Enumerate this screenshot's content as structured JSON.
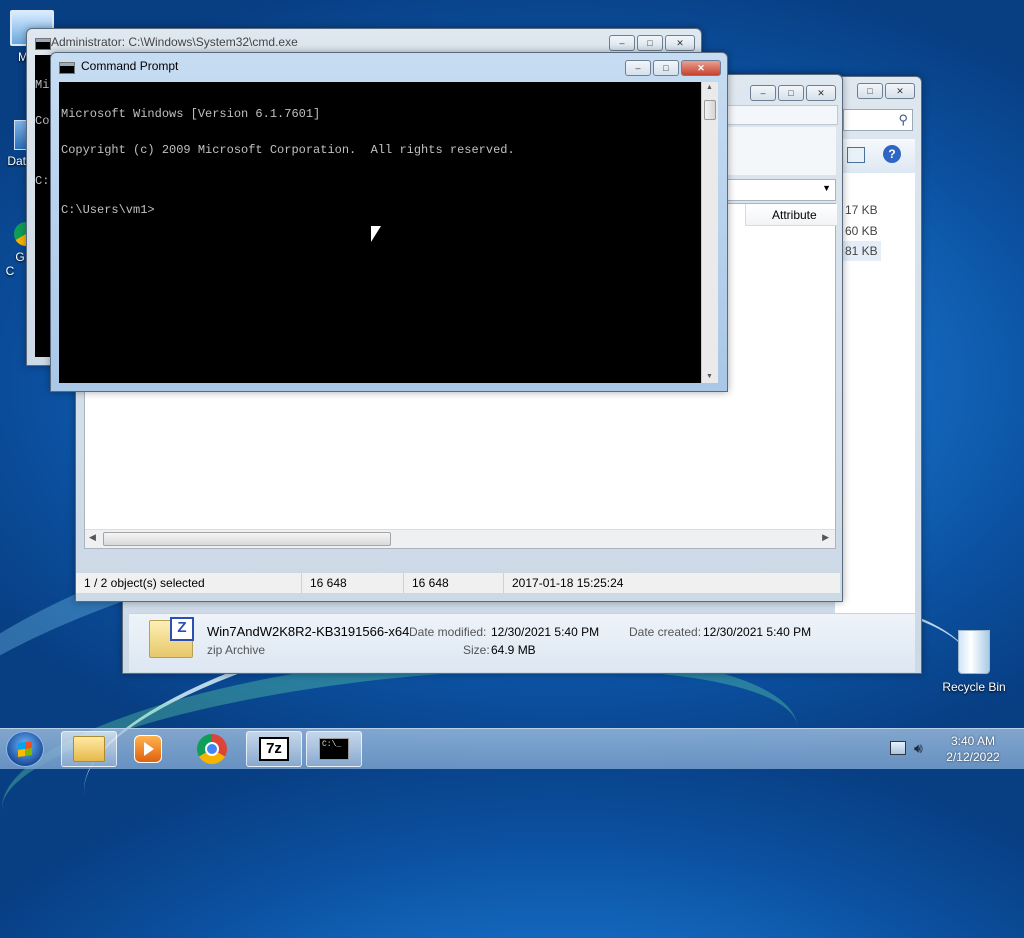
{
  "desktop": {
    "icons": [
      {
        "label": "My C"
      },
      {
        "label": "Data"
      },
      {
        "label": "G\nC"
      },
      {
        "label": "Recycle Bin"
      }
    ]
  },
  "windows": {
    "admin_cmd": {
      "title": "Administrator: C:\\Windows\\System32\\cmd.exe",
      "partial_lines": [
        "Mi",
        "Co",
        "",
        "C:"
      ]
    },
    "cmd": {
      "title": "Command Prompt",
      "lines": [
        "Microsoft Windows [Version 6.1.7601]",
        "Copyright (c) 2009 Microsoft Corporation.  All rights reserved.",
        "",
        "C:\\Users\\vm1>"
      ]
    },
    "sevenzip": {
      "column_header": "Attribute",
      "status": {
        "selected": "1 / 2 object(s) selected",
        "size": "16 648",
        "packed": "16 648",
        "modified": "2017-01-18 15:25:24"
      }
    },
    "explorer": {
      "size_column": [
        "17 KB",
        "60 KB",
        "81 KB"
      ],
      "details": {
        "filename": "Win7AndW2K8R2-KB3191566-x64",
        "type": "zip Archive",
        "date_modified_label": "Date modified:",
        "date_modified": "12/30/2021 5:40 PM",
        "date_created_label": "Date created:",
        "date_created": "12/30/2021 5:40 PM",
        "size_label": "Size:",
        "size": "64.9 MB"
      }
    }
  },
  "taskbar": {
    "buttons": [
      "start-button",
      "explorer",
      "media-player",
      "chrome",
      "7zip",
      "cmd"
    ],
    "sevenzip_label": "7z",
    "cmd_label": "C:\\_",
    "clock": {
      "time": "3:40 AM",
      "date": "2/12/2022"
    }
  }
}
